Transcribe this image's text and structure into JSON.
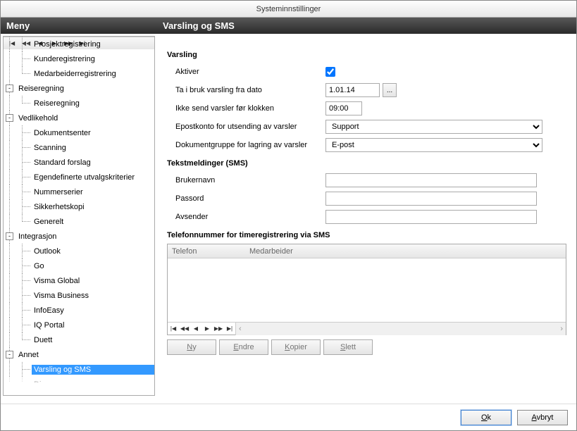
{
  "window": {
    "title": "Systeminnstillinger"
  },
  "sidebar": {
    "header": "Meny",
    "items": [
      {
        "label": "Prosjektregistrering",
        "level": 2,
        "expander": null
      },
      {
        "label": "Kunderegistrering",
        "level": 2,
        "expander": null
      },
      {
        "label": "Medarbeiderregistrering",
        "level": 2,
        "expander": null,
        "last": true
      },
      {
        "label": "Reiseregning",
        "level": 1,
        "expander": "-"
      },
      {
        "label": "Reiseregning",
        "level": 2,
        "expander": null,
        "last": true
      },
      {
        "label": "Vedlikehold",
        "level": 1,
        "expander": "-"
      },
      {
        "label": "Dokumentsenter",
        "level": 2,
        "expander": null
      },
      {
        "label": "Scanning",
        "level": 2,
        "expander": null
      },
      {
        "label": "Standard forslag",
        "level": 2,
        "expander": null
      },
      {
        "label": "Egendefinerte utvalgskriterier",
        "level": 2,
        "expander": null
      },
      {
        "label": "Nummerserier",
        "level": 2,
        "expander": null
      },
      {
        "label": "Sikkerhetskopi",
        "level": 2,
        "expander": null
      },
      {
        "label": "Generelt",
        "level": 2,
        "expander": null,
        "last": true
      },
      {
        "label": "Integrasjon",
        "level": 1,
        "expander": "-"
      },
      {
        "label": "Outlook",
        "level": 2,
        "expander": null
      },
      {
        "label": "Go",
        "level": 2,
        "expander": null
      },
      {
        "label": "Visma Global",
        "level": 2,
        "expander": null
      },
      {
        "label": "Visma Business",
        "level": 2,
        "expander": null
      },
      {
        "label": "InfoEasy",
        "level": 2,
        "expander": null
      },
      {
        "label": "IQ Portal",
        "level": 2,
        "expander": null
      },
      {
        "label": "Duett",
        "level": 2,
        "expander": null,
        "last": true
      },
      {
        "label": "Annet",
        "level": 1,
        "expander": "-"
      },
      {
        "label": "Varsling og SMS",
        "level": 2,
        "expander": null,
        "selected": true
      },
      {
        "label": "Diverse",
        "level": 2,
        "expander": null,
        "cut": true
      }
    ]
  },
  "content": {
    "header": "Varsling og SMS",
    "sections": {
      "varsling": "Varsling",
      "sms": "Tekstmeldinger (SMS)",
      "phone": "Telefonnummer for timeregistrering via SMS"
    },
    "labels": {
      "aktiver": "Aktiver",
      "fradato": "Ta i bruk varsling fra dato",
      "klokken": "Ikke send varsler før klokken",
      "epost": "Epostkonto for utsending av varsler",
      "dokgruppe": "Dokumentgruppe for lagring av varsler",
      "brukernavn": "Brukernavn",
      "passord": "Passord",
      "avsender": "Avsender"
    },
    "values": {
      "aktiver": true,
      "fradato": "1.01.14",
      "klokken": "09:00",
      "epost": "Support",
      "dokgruppe": "E-post",
      "ellipsis": "..."
    },
    "table": {
      "cols": [
        "Telefon",
        "Medarbeider"
      ]
    },
    "actions": {
      "ny": "Ny",
      "endre": "Endre",
      "kopier": "Kopier",
      "slett": "Slett"
    }
  },
  "footer": {
    "ok": "Ok",
    "avbryt": "Avbryt"
  }
}
